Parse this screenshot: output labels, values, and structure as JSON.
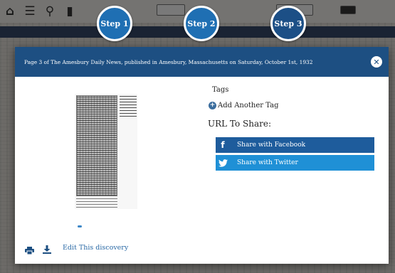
{
  "steps": [
    {
      "label": "Step 1"
    },
    {
      "label": "Step 2"
    },
    {
      "label": "Step 3"
    }
  ],
  "modal": {
    "header_text": "Page 3 of The Amesbury Daily News, published in Amesbury, Massachusetts on Saturday, October 1st, 1932",
    "close_symbol": "✕",
    "tags_title": "Tags",
    "add_tag_label": "Add Another Tag",
    "url_title": "URL To Share:",
    "share_facebook_label": "Share with Facebook",
    "share_twitter_label": "Share with Twitter",
    "edit_label": "Edit This discovery"
  },
  "colors": {
    "header_blue": "#1d4f82",
    "facebook_blue": "#1e5c9c",
    "twitter_blue": "#1f90d6",
    "link_blue": "#2b6aa6"
  },
  "icons": {
    "toolbar": [
      "home-icon",
      "menu-icon",
      "search-icon",
      "bookmark-icon"
    ],
    "share": [
      "facebook-icon",
      "twitter-icon"
    ],
    "footer": [
      "print-icon",
      "download-icon"
    ]
  }
}
